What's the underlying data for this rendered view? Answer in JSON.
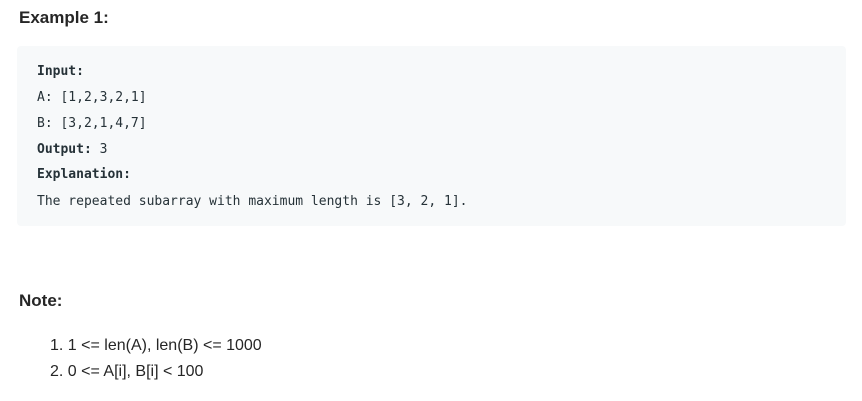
{
  "example": {
    "heading": "Example 1:",
    "input_label": "Input:",
    "line_a": "A: [1,2,3,2,1]",
    "line_b": "B: [3,2,1,4,7]",
    "output_label": "Output:",
    "output_value": " 3",
    "explanation_label": "Explanation:",
    "explanation_text": "The repeated subarray with maximum length is [3, 2, 1]."
  },
  "note": {
    "heading": "Note:",
    "items": [
      {
        "number": "1.",
        "text": "1 <= len(A), len(B) <= 1000"
      },
      {
        "number": "2.",
        "text": "0 <= A[i], B[i] < 100"
      }
    ]
  }
}
